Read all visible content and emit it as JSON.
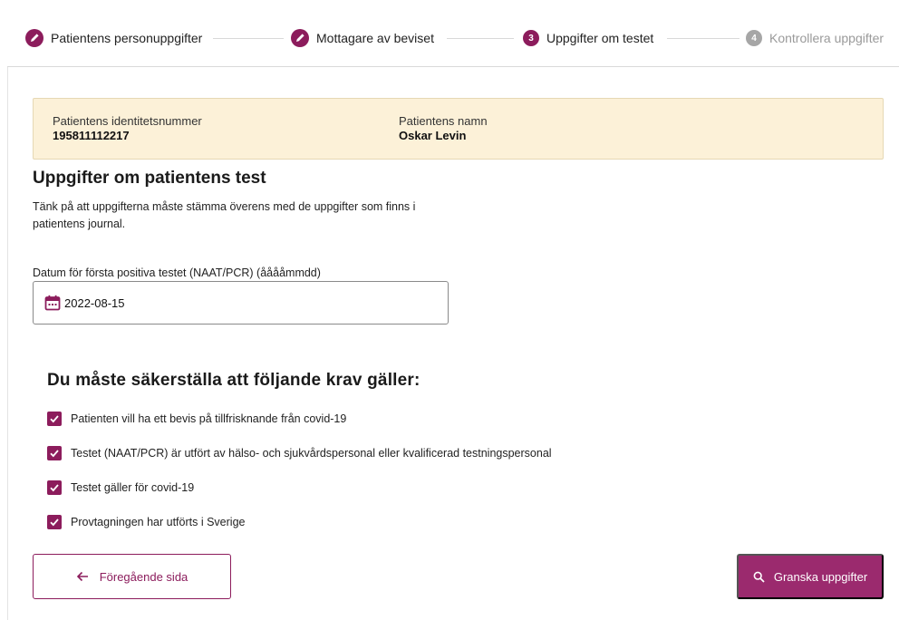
{
  "stepper": {
    "steps": [
      {
        "label": "Patientens personuppgifter",
        "state": "done",
        "icon": "pencil-icon"
      },
      {
        "label": "Mottagare av beviset",
        "state": "done",
        "icon": "pencil-icon"
      },
      {
        "label": "Uppgifter om testet",
        "state": "current",
        "number": "3"
      },
      {
        "label": "Kontrollera uppgifter",
        "state": "todo",
        "number": "4"
      }
    ]
  },
  "patient": {
    "id_label": "Patientens identitetsnummer",
    "id_value": "195811112217",
    "name_label": "Patientens namn",
    "name_value": "Oskar Levin"
  },
  "section": {
    "title": "Uppgifter om patientens test",
    "intro": "Tänk på att uppgifterna måste stämma överens med de uppgifter som finns i patientens journal."
  },
  "date_field": {
    "label": "Datum för första positiva testet (NAAT/PCR) (ååååmmdd)",
    "value": "2022-08-15",
    "icon": "calendar-icon"
  },
  "requirements": {
    "title": "Du måste säkerställa att följande krav gäller:",
    "items": [
      {
        "label": "Patienten vill ha ett bevis på tillfrisknande från covid-19",
        "checked": true
      },
      {
        "label": "Testet (NAAT/PCR) är utfört av hälso- och sjukvårdspersonal eller kvalificerad testningspersonal",
        "checked": true
      },
      {
        "label": "Testet gäller för covid-19",
        "checked": true
      },
      {
        "label": "Provtagningen har utförts i Sverige",
        "checked": true
      }
    ]
  },
  "actions": {
    "back_label": "Föregående sida",
    "review_label": "Granska uppgifter"
  },
  "colors": {
    "accent": "#8c1c5c",
    "banner_bg": "#fcf1d8",
    "step_todo": "#a6a6a6"
  }
}
